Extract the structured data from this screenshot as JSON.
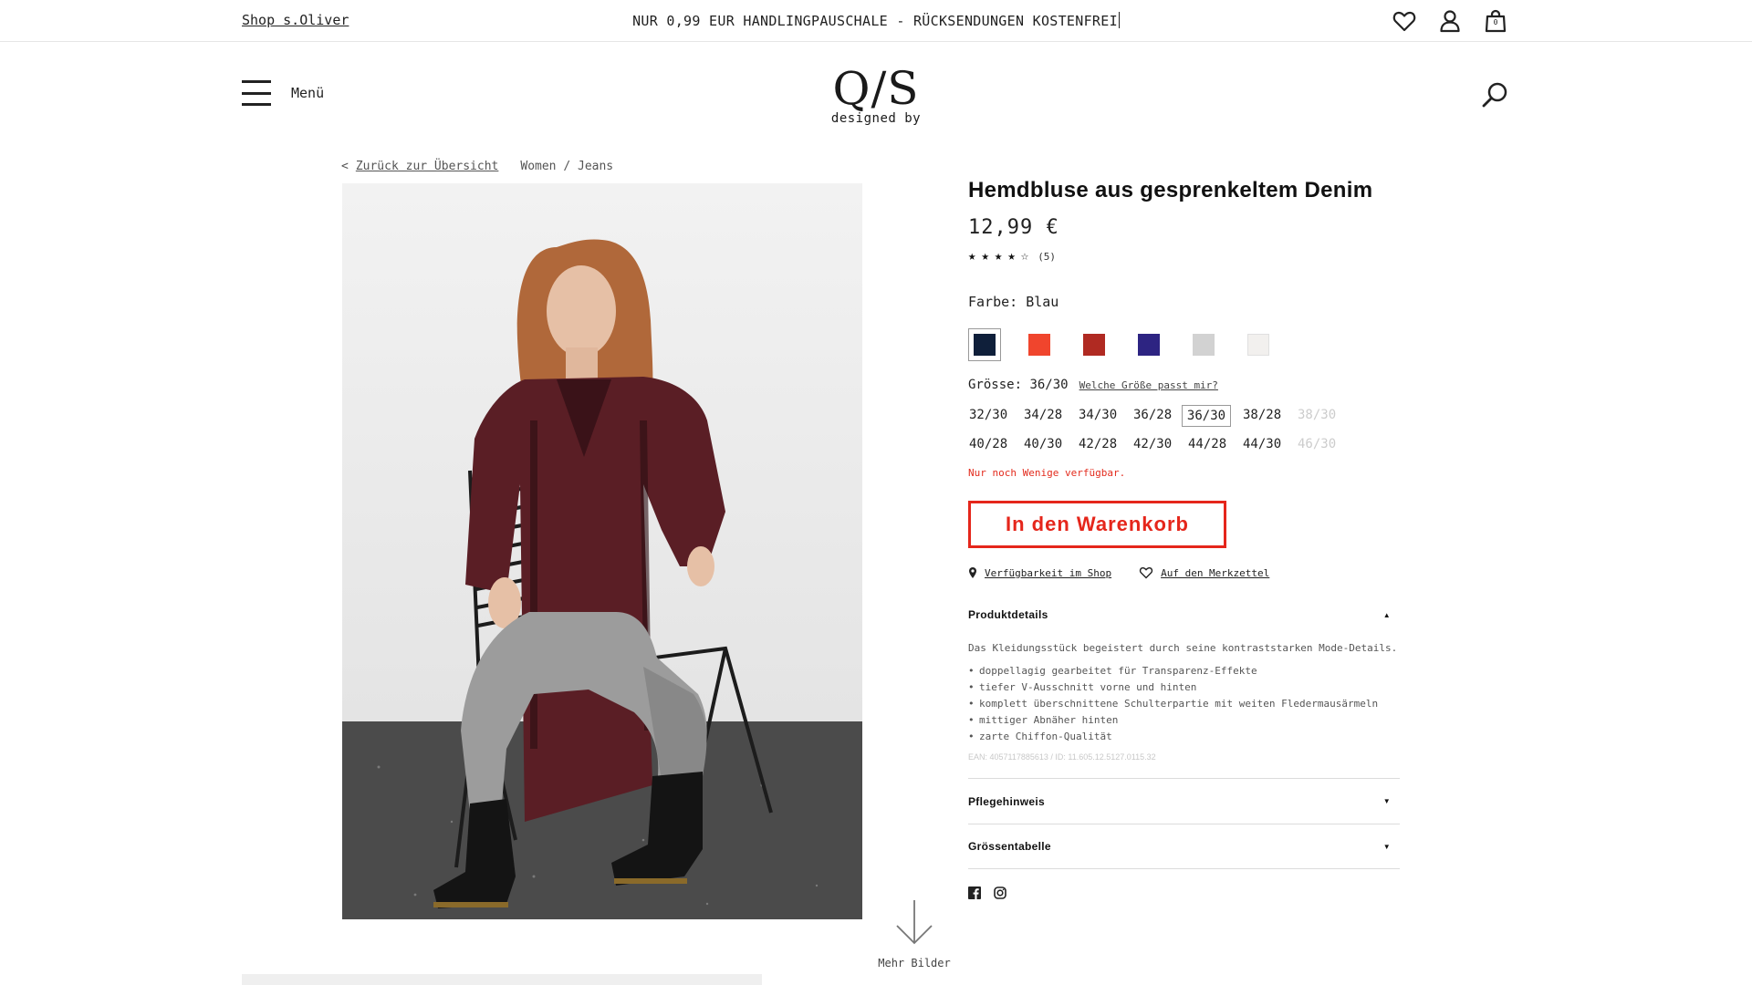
{
  "topbar": {
    "shop_link": "Shop s.Oliver",
    "announcement": "NUR 0,99 EUR HANDLINGPAUSCHALE - RÜCKSENDUNGEN KOSTENFREI",
    "cart_count": "0"
  },
  "header": {
    "menu_label": "Menü",
    "logo_mark": "Q/S",
    "logo_sub": "designed by"
  },
  "breadcrumb": {
    "back_label": "Zurück zur Übersicht",
    "back_prefix": "<",
    "category": "Women / Jeans"
  },
  "product": {
    "title": "Hemdbluse aus gesprenkeltem Denim",
    "price": "12,99 €",
    "rating_value": 4,
    "rating_max": 5,
    "rating_count": "(5)",
    "color_label": "Farbe:",
    "color_value": "Blau",
    "colors": [
      "#0f1f3a",
      "#f0452d",
      "#b02a22",
      "#2d2482",
      "#d2d2d2",
      "#f2f0ee"
    ],
    "selected_color_index": 0,
    "size_label": "Grösse:",
    "size_value": "36/30",
    "size_help": "Welche Größe passt mir?",
    "sizes": [
      {
        "label": "32/30",
        "state": "available"
      },
      {
        "label": "34/28",
        "state": "available"
      },
      {
        "label": "34/30",
        "state": "available"
      },
      {
        "label": "36/28",
        "state": "available"
      },
      {
        "label": "36/30",
        "state": "selected"
      },
      {
        "label": "38/28",
        "state": "available"
      },
      {
        "label": "38/30",
        "state": "disabled"
      },
      {
        "label": "40/28",
        "state": "available"
      },
      {
        "label": "40/30",
        "state": "available"
      },
      {
        "label": "42/28",
        "state": "available"
      },
      {
        "label": "42/30",
        "state": "available"
      },
      {
        "label": "44/28",
        "state": "available"
      },
      {
        "label": "44/30",
        "state": "available"
      },
      {
        "label": "46/30",
        "state": "disabled"
      }
    ],
    "stock_note": "Nur noch Wenige verfügbar.",
    "cart_button": "In den Warenkorb",
    "availability_link": "Verfügbarkeit im Shop",
    "wishlist_link": "Auf den Merkzettel"
  },
  "details": {
    "product_details_title": "Produktdetails",
    "description": "Das Kleidungsstück begeistert durch seine kontraststarken Mode-Details.",
    "bullets": [
      "doppellagig gearbeitet für Transparenz-Effekte",
      "tiefer V-Ausschnitt vorne und hinten",
      "komplett überschnittene Schulterpartie mit weiten Fledermausärmeln",
      "mittiger Abnäher hinten",
      "zarte Chiffon-Qualität"
    ],
    "ean": "EAN: 4057117885613 / ID: 11.605.12.5127.0115.32",
    "care_title": "Pflegehinweis",
    "size_table_title": "Grössentabelle"
  },
  "gallery": {
    "more_label": "Mehr Bilder"
  },
  "colors": {
    "accent_red": "#e5261b"
  }
}
